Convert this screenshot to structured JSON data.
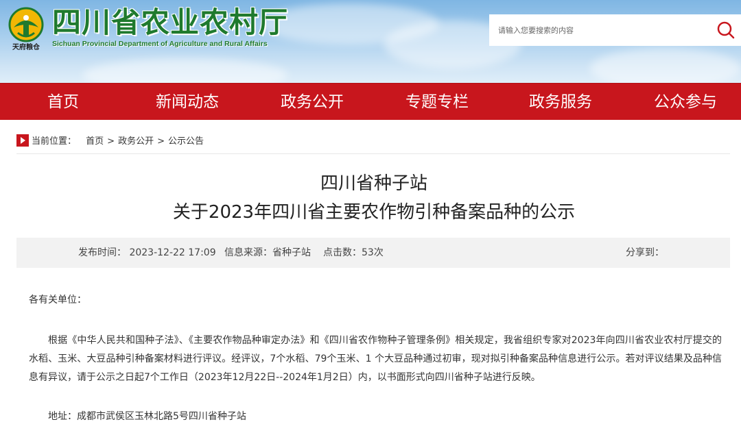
{
  "header": {
    "site_name_cn": "四川省农业农村厅",
    "site_name_en": "Sichuan Provincial Department of Agriculture and Rural Affairs",
    "emblem_sub": "天府粮仓",
    "search_placeholder": "请输入您要搜索的内容",
    "search_icon": "search-icon"
  },
  "nav": {
    "items": [
      "首页",
      "新闻动态",
      "政务公开",
      "专题专栏",
      "政务服务",
      "公众参与"
    ]
  },
  "breadcrumb": {
    "label": "当前位置：",
    "items": [
      "首页",
      "政务公开",
      "公示公告"
    ],
    "separator": ">"
  },
  "article": {
    "title_line1": "四川省种子站",
    "title_line2": "关于2023年四川省主要农作物引种备案品种的公示",
    "meta": {
      "publish_label": "发布时间：",
      "publish_time": "2023-12-22 17:09",
      "source_label": "信息来源：",
      "source": "省种子站",
      "clicks_label": "点击数：",
      "clicks": "53次",
      "share_label": "分享到："
    },
    "greeting": "各有关单位：",
    "paragraph": "根据《中华人民共和国种子法》、《主要农作物品种审定办法》和《四川省农作物种子管理条例》相关规定，我省组织专家对2023年向四川省农业农村厅提交的水稻、玉米、大豆品种引种备案材料进行评议。经评议，7个水稻、79个玉米、1 个大豆品种通过初审，现对拟引种备案品种信息进行公示。若对评议结果及品种信息有异议，请于公示之日起7个工作日（2023年12月22日--2024年1月2日）内，以书面形式向四川省种子站进行反映。",
    "address": "地址：成都市武侯区玉林北路5号四川省种子站"
  },
  "colors": {
    "nav_bg": "#c8161d",
    "logo_green": "#1f7a2e",
    "meta_bg": "#f2f2f2"
  }
}
